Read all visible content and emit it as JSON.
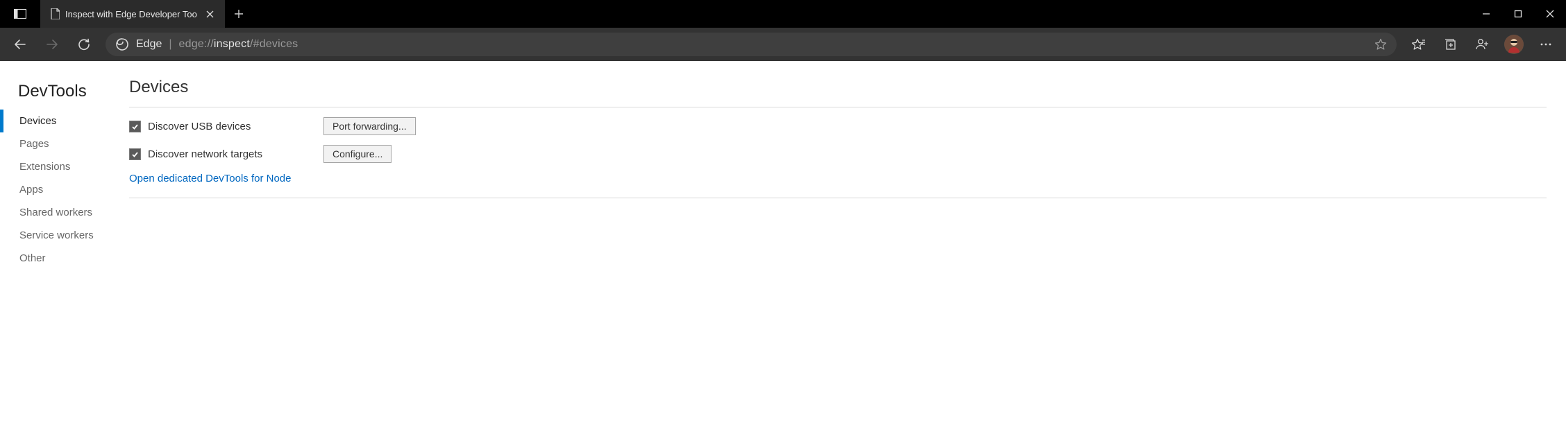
{
  "window": {
    "tab_title": "Inspect with Edge Developer Too"
  },
  "toolbar": {
    "edge_label": "Edge",
    "url_dim_prefix": "edge://",
    "url_strong": "inspect",
    "url_dim_suffix": "/#devices"
  },
  "sidebar": {
    "title": "DevTools",
    "items": [
      {
        "label": "Devices",
        "active": true
      },
      {
        "label": "Pages"
      },
      {
        "label": "Extensions"
      },
      {
        "label": "Apps"
      },
      {
        "label": "Shared workers"
      },
      {
        "label": "Service workers"
      },
      {
        "label": "Other"
      }
    ]
  },
  "main": {
    "title": "Devices",
    "usb_label": "Discover USB devices",
    "port_forwarding_btn": "Port forwarding...",
    "network_label": "Discover network targets",
    "configure_btn": "Configure...",
    "node_link": "Open dedicated DevTools for Node"
  }
}
